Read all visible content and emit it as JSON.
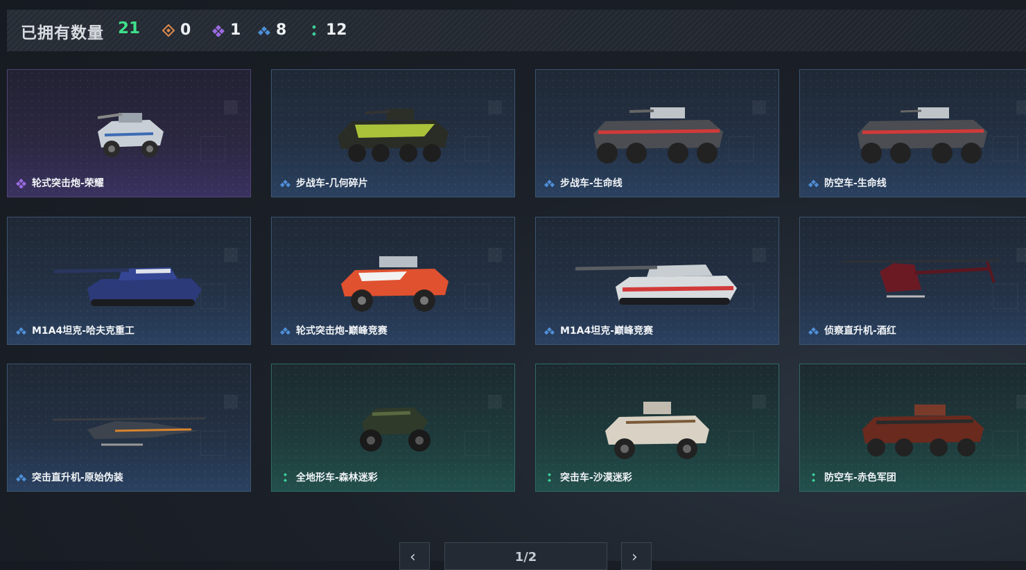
{
  "header": {
    "owned_label": "已拥有数量",
    "owned_total": "21",
    "counts": [
      {
        "icon": "orange-diamond-icon",
        "color": "#e08a4c",
        "value": "0"
      },
      {
        "icon": "purple-diamond-icon",
        "color": "#9b6be0",
        "value": "1"
      },
      {
        "icon": "blue-diamond-icon",
        "color": "#4f8fd8",
        "value": "8"
      },
      {
        "icon": "green-diamond-icon",
        "color": "#3ecf9a",
        "value": "12"
      }
    ]
  },
  "cards": [
    {
      "name": "轮式突击炮-荣耀",
      "rarity": "purple"
    },
    {
      "name": "步战车-几何碎片",
      "rarity": "blue"
    },
    {
      "name": "步战车-生命线",
      "rarity": "blue"
    },
    {
      "name": "防空车-生命线",
      "rarity": "blue"
    },
    {
      "name": "M1A4坦克-哈夫克重工",
      "rarity": "blue"
    },
    {
      "name": "轮式突击炮-巅峰竞赛",
      "rarity": "blue"
    },
    {
      "name": "M1A4坦克-巅峰竞赛",
      "rarity": "blue"
    },
    {
      "name": "侦察直升机-酒红",
      "rarity": "blue"
    },
    {
      "name": "突击直升机-原始伪装",
      "rarity": "blue"
    },
    {
      "name": "全地形车-森林迷彩",
      "rarity": "green"
    },
    {
      "name": "突击车-沙漠迷彩",
      "rarity": "green"
    },
    {
      "name": "防空车-赤色军团",
      "rarity": "green"
    }
  ],
  "pagination": {
    "page": "1/2"
  },
  "colors": {
    "accent_green": "#3ee08a",
    "purple": "#9b6be0",
    "blue": "#4f8fd8",
    "green": "#3ecf9a"
  }
}
